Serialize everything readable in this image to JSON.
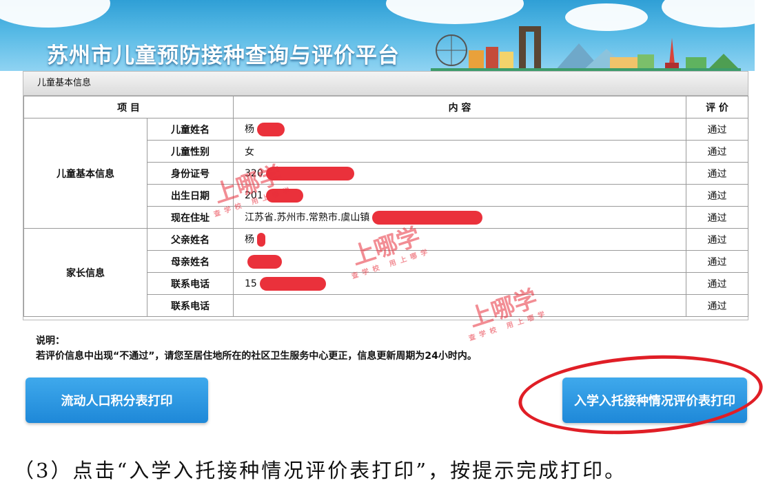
{
  "banner": {
    "title": "苏州市儿童预防接种查询与评价平台"
  },
  "panel": {
    "header": "儿童基本信息",
    "columns": {
      "item": "项 目",
      "content": "内 容",
      "eval": "评 价"
    },
    "groups": [
      {
        "name": "儿童基本信息",
        "rows": [
          {
            "label": "儿童姓名",
            "value": "杨",
            "eval": "通过"
          },
          {
            "label": "儿童性别",
            "value": "女",
            "eval": "通过"
          },
          {
            "label": "身份证号",
            "value": "320",
            "eval": "通过"
          },
          {
            "label": "出生日期",
            "value": "201",
            "eval": "通过"
          },
          {
            "label": "现在住址",
            "value": "江苏省.苏州市.常熟市.虞山镇",
            "eval": "通过"
          }
        ]
      },
      {
        "name": "家长信息",
        "rows": [
          {
            "label": "父亲姓名",
            "value": "杨",
            "eval": "通过"
          },
          {
            "label": "母亲姓名",
            "value": "",
            "eval": "通过"
          },
          {
            "label": "联系电话",
            "value": "15",
            "eval": "通过"
          },
          {
            "label": "联系电话",
            "value": "",
            "eval": "通过"
          }
        ]
      }
    ]
  },
  "notes": {
    "title": "说明：",
    "text": "若评价信息中出现“不通过”，请您至居住地所在的社区卫生服务中心更正，信息更新周期为24小时内。"
  },
  "buttons": {
    "left": "流动人口积分表打印",
    "right": "入学入托接种情况评价表打印"
  },
  "watermark": {
    "big": "上哪学",
    "small": "查学校 用上哪学"
  },
  "caption": "（3）点击“入学入托接种情况评价表打印”，按提示完成打印。",
  "colors": {
    "accent": "#1e88d8",
    "highlight": "#e01e26"
  }
}
